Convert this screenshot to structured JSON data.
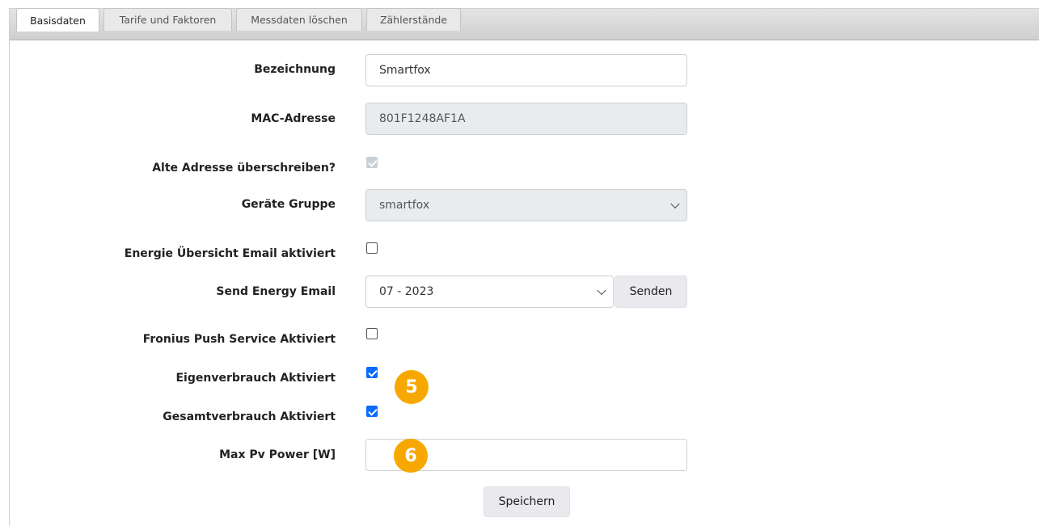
{
  "tabs": [
    {
      "label": "Basisdaten",
      "active": true
    },
    {
      "label": "Tarife und Faktoren",
      "active": false
    },
    {
      "label": "Messdaten löschen",
      "active": false
    },
    {
      "label": "Zählerstände",
      "active": false
    }
  ],
  "form": {
    "bezeichnung": {
      "label": "Bezeichnung",
      "value": "Smartfox"
    },
    "mac": {
      "label": "MAC-Adresse",
      "value": "801F1248AF1A"
    },
    "alte_adresse": {
      "label": "Alte Adresse überschreiben?",
      "checked": true,
      "disabled": true
    },
    "geraete_gruppe": {
      "label": "Geräte Gruppe",
      "value": "smartfox"
    },
    "energie_uebersicht": {
      "label": "Energie Übersicht Email aktiviert",
      "checked": false
    },
    "send_energy": {
      "label": "Send Energy Email",
      "value": "07 - 2023",
      "button": "Senden"
    },
    "fronius": {
      "label": "Fronius Push Service Aktiviert",
      "checked": false
    },
    "eigenverbrauch": {
      "label": "Eigenverbrauch Aktiviert",
      "checked": true
    },
    "gesamtverbrauch": {
      "label": "Gesamtverbrauch Aktiviert",
      "checked": true
    },
    "max_pv": {
      "label": "Max Pv Power [W]",
      "value": ""
    },
    "save_button": "Speichern"
  },
  "annotations": {
    "badge_5": "5",
    "badge_6": "6",
    "color": "#f7a800"
  },
  "colors": {
    "checkbox_checked": "#0b6bff",
    "disabled_field": "#e9ecef"
  }
}
